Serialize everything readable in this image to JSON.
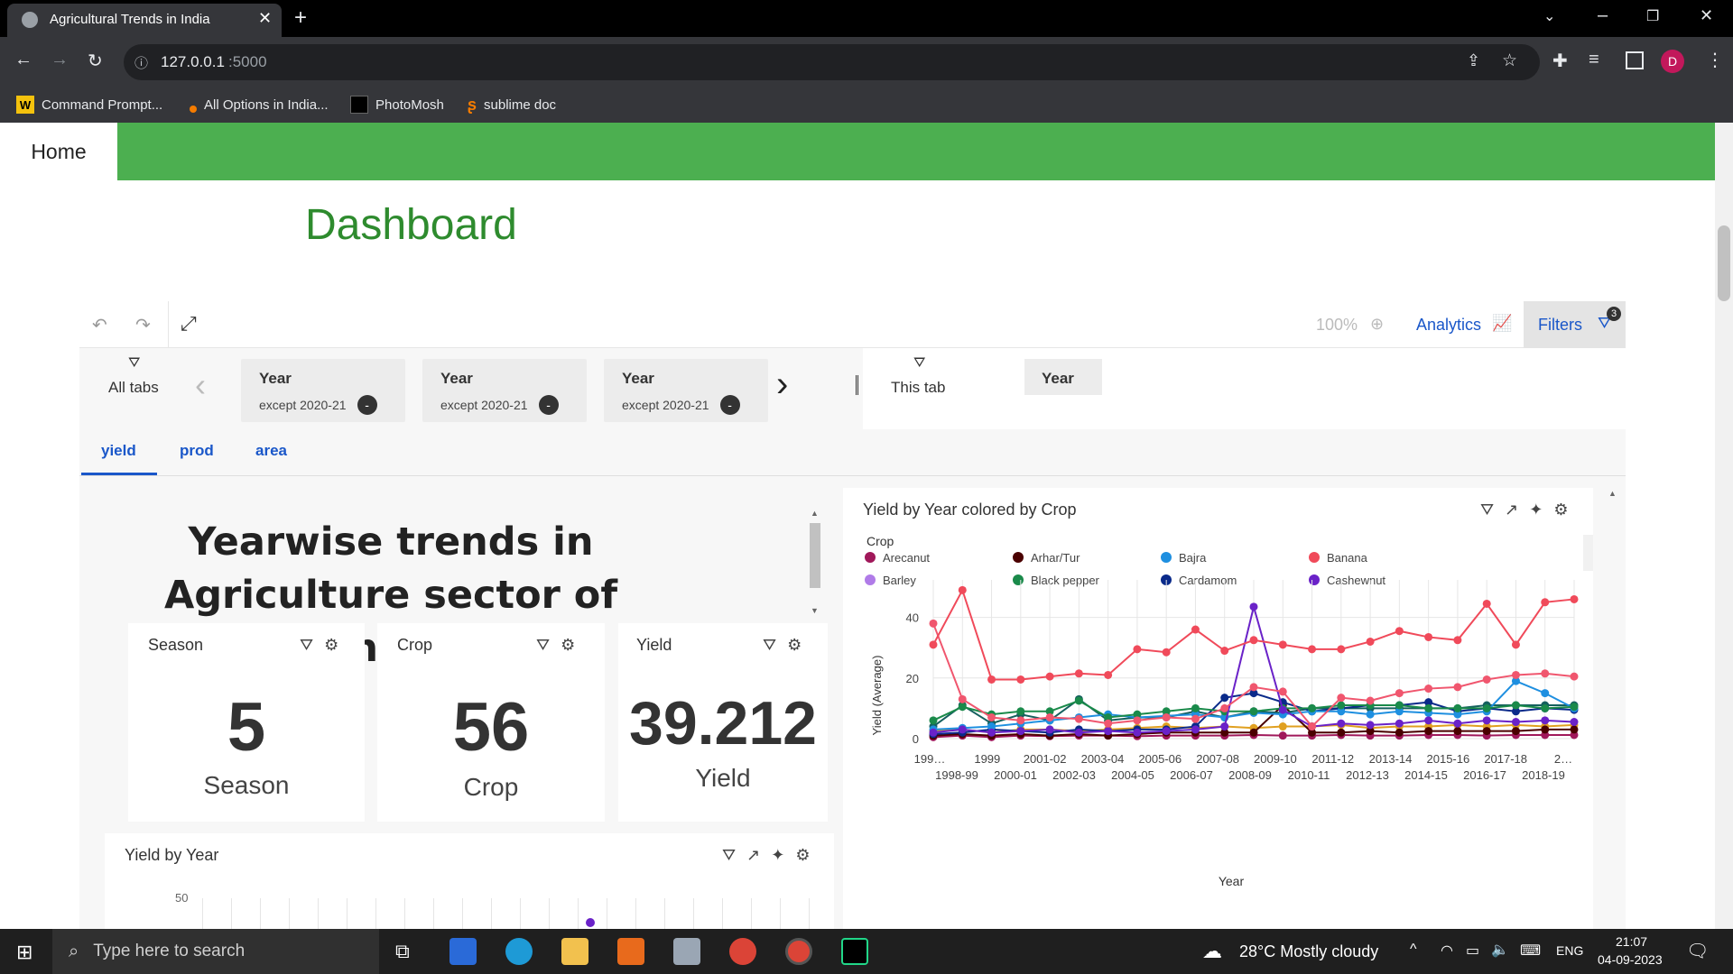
{
  "browser": {
    "tab_title": "Agricultural Trends in India",
    "new_tab": "+",
    "url_host": "127.0.0.1",
    "url_port": ":5000",
    "profile_initial": "D",
    "bookmarks": [
      "Command Prompt...",
      "All Options in India...",
      "PhotoMosh",
      "sublime doc"
    ]
  },
  "nav": {
    "home": "Home"
  },
  "dashboard": {
    "title": "Dashboard",
    "zoom": "100%",
    "analytics": "Analytics",
    "filters": "Filters",
    "filters_count": "3",
    "all_tabs": "All tabs",
    "this_tab": "This tab",
    "filter_chips": [
      {
        "title": "Year",
        "sub": "except 2020-21"
      },
      {
        "title": "Year",
        "sub": "except 2020-21"
      },
      {
        "title": "Year",
        "sub": "except 2020-21"
      }
    ],
    "this_tab_chip": "Year",
    "tabs": [
      "yield",
      "prod",
      "area"
    ],
    "active_tab": "yield"
  },
  "text_card": {
    "heading": "Yearwise trends in Agriculture sector of India"
  },
  "kpis": [
    {
      "header": "Season",
      "value": "5",
      "label": "Season"
    },
    {
      "header": "Crop",
      "value": "56",
      "label": "Crop"
    },
    {
      "header": "Yield",
      "value": "39.212",
      "label": "Yield"
    }
  ],
  "yield_by_year_card": {
    "title": "Yield by Year",
    "ytick_top": "50"
  },
  "next_card_peek": {
    "title": "Yield by Year colored by Crop"
  },
  "colors": {
    "navbar": "#4caf50",
    "title_green": "#2e8b2e",
    "tab_blue": "#1a57c9"
  },
  "chart_data": {
    "type": "line",
    "title": "Yield by Year colored by Crop",
    "xlabel": "Year",
    "ylabel": "Yield (Average)",
    "legend_title": "Crop",
    "legend_placement": "top",
    "legend": [
      {
        "name": "Arecanut",
        "color": "#a0185a"
      },
      {
        "name": "Arhar/Tur",
        "color": "#4a0000"
      },
      {
        "name": "Bajra",
        "color": "#1e8fe0"
      },
      {
        "name": "Banana",
        "color": "#f04a5a"
      },
      {
        "name": "Barley",
        "color": "#b07be8"
      },
      {
        "name": "Black pepper",
        "color": "#1a8a4a"
      },
      {
        "name": "Cardamom",
        "color": "#0a2a8a"
      },
      {
        "name": "Cashewnut",
        "color": "#6a22c8"
      }
    ],
    "x_top": [
      "199…",
      "1999",
      "2001-02",
      "2003-04",
      "2005-06",
      "2007-08",
      "2009-10",
      "2011-12",
      "2013-14",
      "2015-16",
      "2017-18",
      "2…"
    ],
    "x_bottom": [
      "1998-99",
      "2000-01",
      "2002-03",
      "2004-05",
      "2006-07",
      "2008-09",
      "2010-11",
      "2012-13",
      "2014-15",
      "2016-17",
      "2018-19"
    ],
    "y_ticks": [
      "0",
      "20",
      "40"
    ],
    "ylim": [
      0,
      50
    ],
    "grid": true,
    "series": [
      {
        "color": "#f04a5a",
        "values": [
          31,
          49,
          19.5,
          19.5,
          20.5,
          21.5,
          21,
          29.5,
          28.5,
          36,
          29,
          32.5,
          31,
          29.5,
          29.5,
          32,
          35.5,
          33.5,
          32.5,
          44.5,
          31,
          45,
          46
        ]
      },
      {
        "color": "#f0566e",
        "values": [
          38,
          13,
          7,
          6,
          7,
          6.5,
          5,
          6,
          7,
          6.5,
          10,
          17,
          15.5,
          4,
          13.5,
          12.5,
          15,
          16.5,
          17,
          19.5,
          21,
          21.5,
          20.5
        ]
      },
      {
        "color": "#6a22c8",
        "values": [
          2,
          3,
          2,
          2.5,
          3,
          2,
          2.5,
          2,
          2.5,
          3,
          4,
          43.5,
          9.5,
          4,
          5,
          4.5,
          5,
          6,
          5,
          6,
          5.5,
          6,
          5.5
        ]
      },
      {
        "color": "#1a8a4a",
        "values": [
          6,
          10.5,
          8,
          9,
          9,
          12.5,
          7,
          8,
          9,
          10,
          9,
          9,
          10,
          10,
          11,
          11,
          11,
          10,
          10,
          10,
          11,
          10,
          10.5
        ]
      },
      {
        "color": "#1e8fe0",
        "values": [
          3,
          3.5,
          4,
          5,
          6,
          7,
          8,
          7,
          7.5,
          8,
          7,
          8.5,
          8,
          9,
          9,
          8,
          9,
          8.5,
          8,
          9,
          19,
          15,
          10
        ]
      },
      {
        "color": "#0a2a8a",
        "values": [
          1.5,
          2,
          3,
          2.5,
          2,
          3,
          2.5,
          3,
          3,
          4,
          13.5,
          15,
          12,
          9,
          10,
          11,
          11,
          12,
          9,
          10,
          9,
          10,
          9.5
        ]
      },
      {
        "color": "#15605e",
        "values": [
          4,
          11,
          5,
          8,
          6,
          13,
          6,
          7,
          7,
          9,
          7,
          9,
          8.5,
          10,
          10,
          10,
          10,
          10,
          10,
          11,
          11,
          11,
          11
        ]
      },
      {
        "color": "#4a0000",
        "values": [
          1,
          1.5,
          1,
          1.5,
          1,
          1.5,
          1,
          1.5,
          2,
          2,
          2,
          2,
          11,
          2,
          2,
          2.5,
          2,
          2.5,
          2.5,
          2.5,
          2.5,
          3,
          3
        ]
      },
      {
        "color": "#e0a020",
        "values": [
          2.5,
          3,
          2,
          3,
          3,
          2.5,
          3,
          3.5,
          4,
          3.5,
          4,
          3.5,
          4,
          4,
          4.5,
          3.5,
          4,
          4,
          4.5,
          4,
          4.5,
          4,
          4.5
        ]
      },
      {
        "color": "#a0185a",
        "values": [
          0.5,
          1,
          0.5,
          1,
          0.8,
          1,
          1,
          0.8,
          1,
          1,
          1,
          1.2,
          1,
          1,
          1.2,
          1,
          1,
          1.2,
          1.2,
          1,
          1.2,
          1.2,
          1.2
        ]
      }
    ]
  },
  "taskbar": {
    "search_placeholder": "Type here to search",
    "weather": "28°C  Mostly cloudy",
    "lang": "ENG",
    "time": "21:07",
    "date": "04-09-2023"
  }
}
